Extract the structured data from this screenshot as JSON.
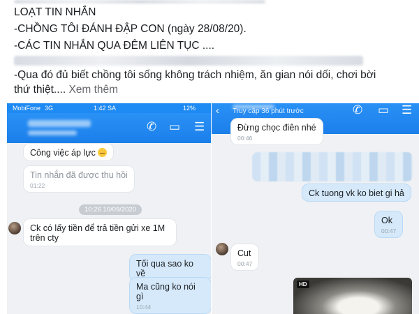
{
  "post": {
    "line1": "LOẠT TIN NHẮN",
    "line2": "-CHỒNG TÔI ĐÁNH ĐẬP CON (ngày 28/08/20).",
    "line3": "-CÁC TIN NHẮN QUA ĐÊM LIÊN TỤC ....",
    "line4": "-Qua đó đủ biết chồng tôi sống không trách nhiệm, ăn gian nói dối, chơi bời",
    "line5_text": "thứ thiệt....",
    "see_more": "Xem thêm"
  },
  "left_phone": {
    "status": {
      "carrier": "MobiFone",
      "network": "3G",
      "time": "1:42 SA",
      "battery": "12%"
    },
    "messages": [
      {
        "text": "Công việc áp lực",
        "time": ""
      },
      {
        "text": "Tin nhắn đã được thu hồi",
        "time": "01:22"
      },
      {
        "text": "Ck có lấy tiền để trả tiền gửi xe 1M trên cty",
        "time": ""
      },
      {
        "text": "Tối qua sao ko về",
        "time": ""
      },
      {
        "text": "Ma cũng ko nói gì",
        "time": "10:44"
      }
    ],
    "date_divider": "10:26 10/09/2020"
  },
  "right_phone": {
    "header_sub": "Truy cập 36 phút trước",
    "messages": [
      {
        "text": "Đừng chọc điên nhé",
        "time": "00:46"
      },
      {
        "text": "Ck tuong vk ko biet gi hả",
        "time": ""
      },
      {
        "text": "Ok",
        "time": "00:47"
      },
      {
        "text": "Cut",
        "time": "00:47"
      }
    ],
    "video_badge": "HD"
  }
}
